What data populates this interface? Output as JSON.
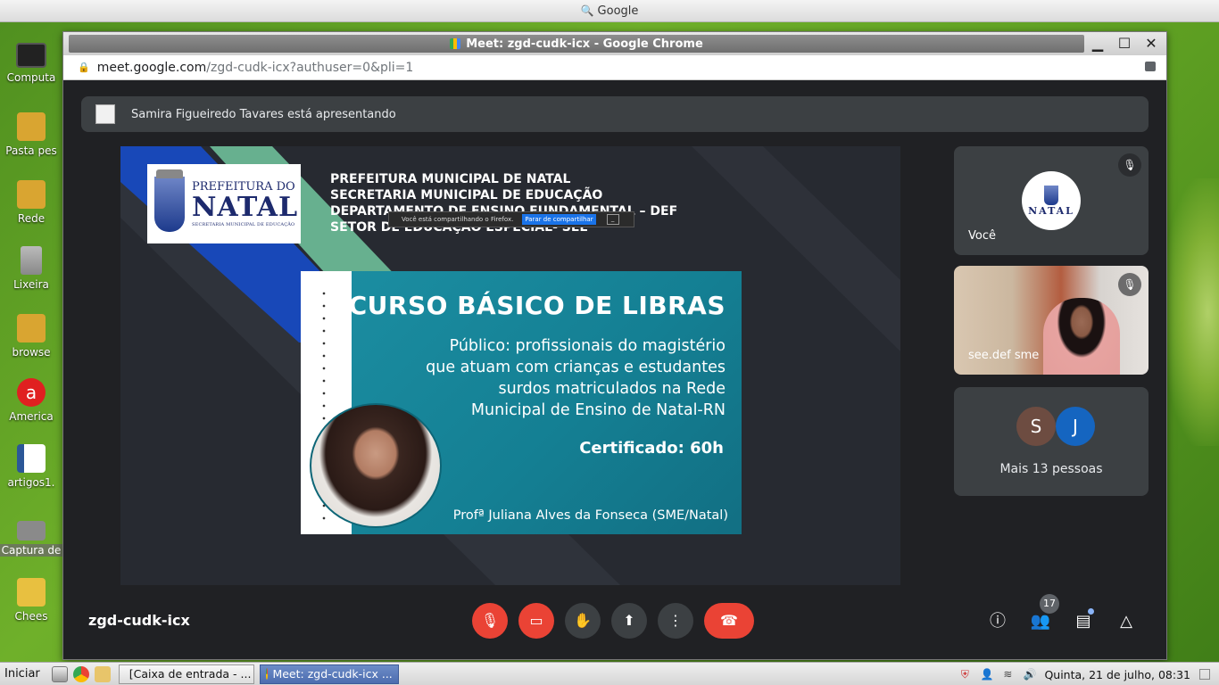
{
  "os_top": {
    "title": "Google",
    "search_icon": "search-icon"
  },
  "desktop_icons": [
    {
      "label": "Computa",
      "color": "#222222"
    },
    {
      "label": "Pasta pes",
      "color": "#d9a531"
    },
    {
      "label": "Rede",
      "color": "#d9a531"
    },
    {
      "label": "Lixeira",
      "color": "#9a9a9a"
    },
    {
      "label": "browse",
      "color": "#d9a531"
    },
    {
      "label": "America",
      "color": "#e02020"
    },
    {
      "label": "artigos1.",
      "color": "#2b5797"
    },
    {
      "label": "Captura de",
      "color": "#8a8a8a"
    },
    {
      "label": "Chees",
      "color": "#e8c040"
    }
  ],
  "window": {
    "title": "Meet: zgd-cudk-icx - Google Chrome",
    "minimize": "▁",
    "maximize": "☐",
    "close": "✕"
  },
  "address": {
    "host": "meet.google.com",
    "path": "/zgd-cudk-icx?authuser=0&pli=1"
  },
  "meet": {
    "presenting_text": "Samira Figueiredo Tavares está apresentando",
    "slide": {
      "logo_line1": "PREFEITURA DO",
      "logo_line2": "NATAL",
      "logo_line3": "SECRETARIA MUNICIPAL DE EDUCAÇÃO",
      "header": [
        "PREFEITURA MUNICIPAL DE NATAL",
        "SECRETARIA MUNICIPAL DE EDUCAÇÃO",
        "DEPARTAMENTO DE ENSINO FUNDAMENTAL – DEF",
        "SETOR DE EDUCAÇÃO ESPECIAL- SEE"
      ],
      "share_popup_text": "Você está compartilhando o Firefox.",
      "share_popup_button": "Parar de compartilhar",
      "share_popup_min": "_",
      "course_title": "CURSO BÁSICO DE LIBRAS",
      "audience_lines": [
        "Público: profissionais do magistério",
        "que atuam com crianças e estudantes",
        "surdos matriculados na Rede",
        "Municipal de Ensino de Natal-RN"
      ],
      "certificate": "Certificado: 60h",
      "professor": "Profª Juliana Alves da Fonseca (SME/Natal)"
    },
    "tiles": {
      "self_name": "Você",
      "self_logo_text": "NATAL",
      "video_name": "see.def sme",
      "more_avatars": [
        {
          "letter": "S",
          "color": "#6d4c41"
        },
        {
          "letter": "J",
          "color": "#1565c0"
        }
      ],
      "more_label": "Mais 13 pessoas"
    },
    "meeting_code": "zgd-cudk-icx",
    "participants_count": "17"
  },
  "taskbar": {
    "start": "Iniciar",
    "tasks": [
      {
        "label": "[Caixa de entrada - ...",
        "active": false
      },
      {
        "label": "Meet: zgd-cudk-icx ...",
        "active": true
      }
    ],
    "clock": "Quinta, 21 de julho, 08:31"
  }
}
